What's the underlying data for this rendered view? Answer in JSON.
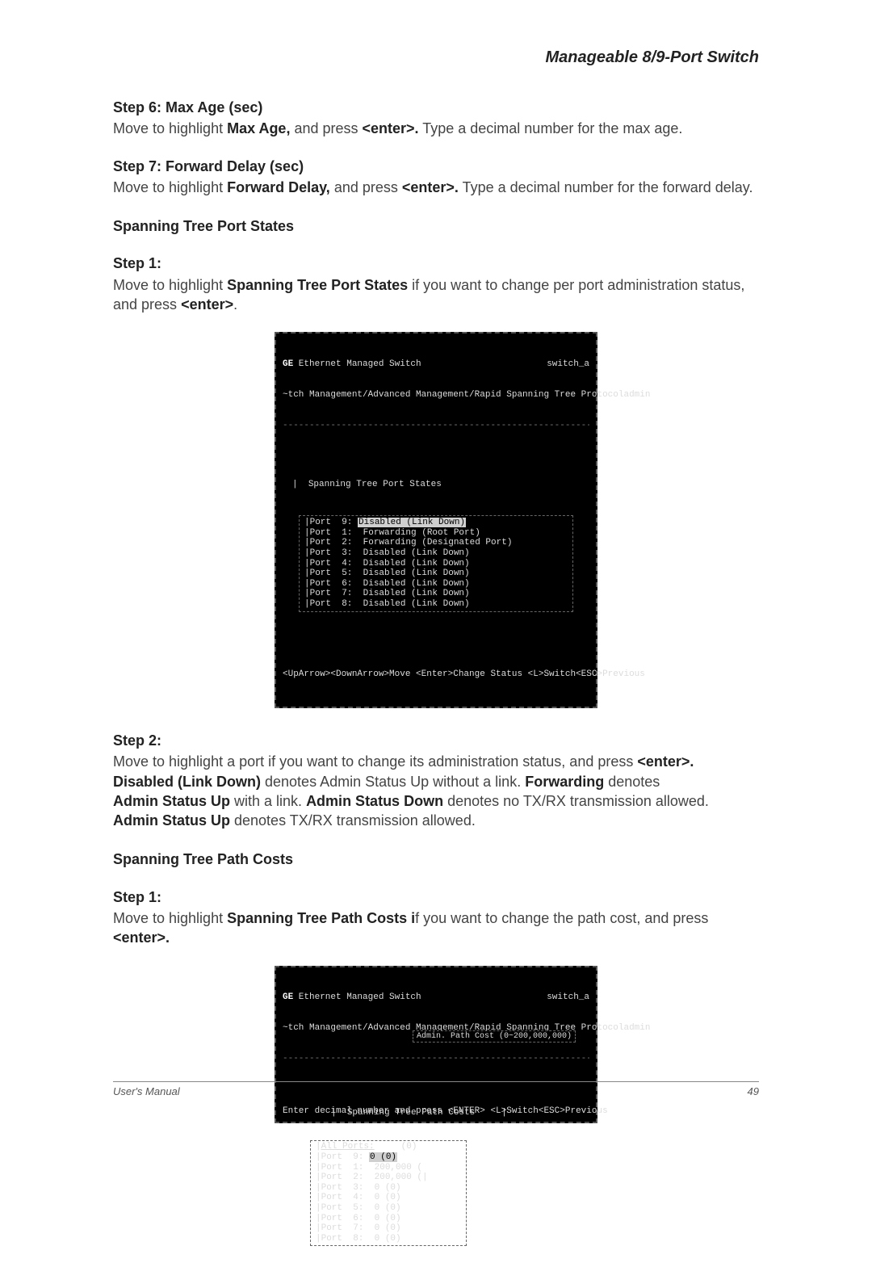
{
  "header": "Manageable 8/9-Port Switch",
  "step6": {
    "title": "Step 6: Max Age (sec)",
    "text_a": "Move to highlight ",
    "bold_a": "Max Age,",
    "text_b": " and press ",
    "bold_b": "<enter>.",
    "text_c": " Type a decimal number for the max age."
  },
  "step7": {
    "title": "Step 7: Forward Delay (sec)",
    "text_a": "Move to highlight ",
    "bold_a": "Forward Delay,",
    "text_b": " and press ",
    "bold_b": "<enter>.",
    "text_c": " Type a decimal number for the forward delay."
  },
  "section_states": "Spanning Tree Port States",
  "states_step1": {
    "title": "Step 1:",
    "text_a": "Move to highlight ",
    "bold_a": "Spanning Tree Port States",
    "text_b": " if you want to change per port administration status, and press ",
    "bold_b": "<enter>",
    "text_c": "."
  },
  "term1": {
    "title_left_bold": "GE",
    "title_left_rest": " Ethernet Managed Switch",
    "title_right_a": "switch_a",
    "title_right_b": "admin",
    "breadcrumb": "~tch Management/Advanced Management/Rapid Spanning Tree Protocol",
    "box_title": "Spanning Tree Port States",
    "ports": [
      {
        "label": "Port  9:",
        "hl": "Disabled (Link Down)"
      },
      {
        "label": "Port  1:",
        "rest": " Forwarding (Root Port)"
      },
      {
        "label": "Port  2:",
        "rest": " Forwarding (Designated Port)"
      },
      {
        "label": "Port  3:",
        "rest": " Disabled (Link Down)"
      },
      {
        "label": "Port  4:",
        "rest": " Disabled (Link Down)"
      },
      {
        "label": "Port  5:",
        "rest": " Disabled (Link Down)"
      },
      {
        "label": "Port  6:",
        "rest": " Disabled (Link Down)"
      },
      {
        "label": "Port  7:",
        "rest": " Disabled (Link Down)"
      },
      {
        "label": "Port  8:",
        "rest": " Disabled (Link Down)"
      }
    ],
    "footer_left": "<UpArrow><DownArrow>Move <Enter>Change Status <L>Switch",
    "footer_right": "<ESC>Previous"
  },
  "states_step2": {
    "title": "Step 2:",
    "line1_a": "Move to highlight a port if you want to change its administration status, and press ",
    "line1_b": "<enter>.",
    "line2_b1": "Disabled (Link Down)",
    "line2_a": " denotes Admin Status Up without a link. ",
    "line2_b2": "Forwarding",
    "line2_c": " denotes ",
    "line3_b1": "Admin Status Up",
    "line3_a": " with a link. ",
    "line3_b2": "Admin Status Down",
    "line3_c": " denotes no TX/RX transmission allowed. ",
    "line4_b1": "Admin Status Up",
    "line4_a": " denotes TX/RX transmission allowed."
  },
  "section_costs": "Spanning Tree Path Costs",
  "costs_step1": {
    "title": "Step 1:",
    "text_a": "Move to highlight ",
    "bold_a": "Spanning Tree Path Costs i",
    "text_b": "f you want to change the path cost, and press ",
    "bold_b": "<enter>."
  },
  "term2": {
    "title_left_bold": "GE",
    "title_left_rest": " Ethernet Managed Switch",
    "title_right_a": "switch_a",
    "title_right_b": "admin",
    "breadcrumb": "~tch Management/Advanced Management/Rapid Spanning Tree Protocol",
    "box_title": "Spanning Tree Path Costs",
    "allports": "All Ports:     (0)",
    "ports": [
      {
        "label": "Port  9:",
        "hl": "0 (0)"
      },
      {
        "label": "Port  1:",
        "rest": " 200,000 ("
      },
      {
        "label": "Port  2:",
        "rest": " 200,000 (|"
      },
      {
        "label": "Port  3:",
        "rest": " 0 (0)"
      },
      {
        "label": "Port  4:",
        "rest": " 0 (0)"
      },
      {
        "label": "Port  5:",
        "rest": " 0 (0)"
      },
      {
        "label": "Port  6:",
        "rest": " 0 (0)"
      },
      {
        "label": "Port  7:",
        "rest": " 0 (0)"
      },
      {
        "label": "Port  8:",
        "rest": " 0 (0)"
      }
    ],
    "popup": "Admin. Path Cost (0~200,000,000)",
    "footer_left": "Enter decimal number and press <ENTER> <L>Switch",
    "footer_right": "<ESC>Previous"
  },
  "footer": {
    "left": "User's Manual",
    "right": "49"
  }
}
